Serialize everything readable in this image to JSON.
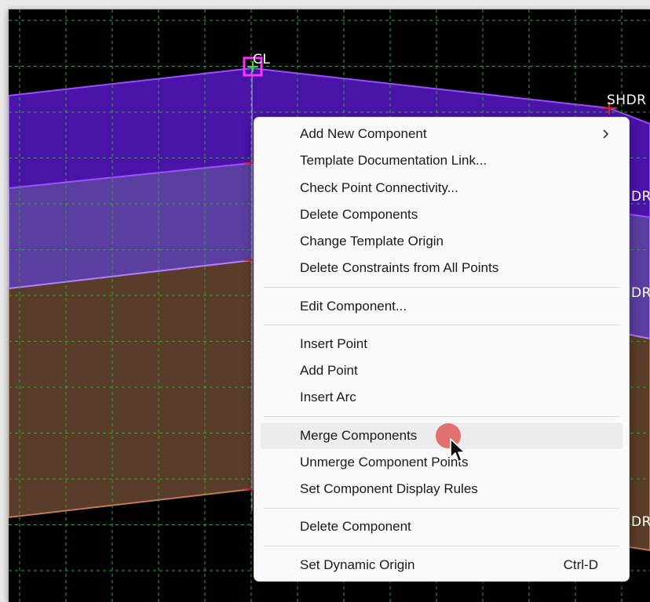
{
  "canvas": {
    "point_labels": {
      "cl": "CL",
      "shdr_top": "SHDR",
      "right_1": "DR",
      "right_2": "DR",
      "right_3": "DR"
    },
    "colors": {
      "background": "#000000",
      "grid": "#1fb41f",
      "top_component": "#4a14a8",
      "middle_component": "#5a3ea0",
      "bottom_component": "#5a3c2a",
      "selection": "#ff33ff",
      "constraint_marker": "#e02020"
    }
  },
  "menu": {
    "groups": [
      [
        {
          "label": "Add New Component",
          "submenu": true
        },
        {
          "label": "Template Documentation Link..."
        },
        {
          "label": "Check Point Connectivity..."
        },
        {
          "label": "Delete Components"
        },
        {
          "label": "Change Template Origin"
        },
        {
          "label": "Delete Constraints from All Points"
        }
      ],
      [
        {
          "label": "Edit Component..."
        }
      ],
      [
        {
          "label": "Insert Point"
        },
        {
          "label": "Add Point"
        },
        {
          "label": "Insert Arc"
        }
      ],
      [
        {
          "label": "Merge Components",
          "hover": true
        },
        {
          "label": "Unmerge Component Points"
        },
        {
          "label": "Set Component Display Rules"
        }
      ],
      [
        {
          "label": "Delete Component"
        }
      ],
      [
        {
          "label": "Set Dynamic Origin",
          "shortcut": "Ctrl-D"
        }
      ]
    ]
  }
}
